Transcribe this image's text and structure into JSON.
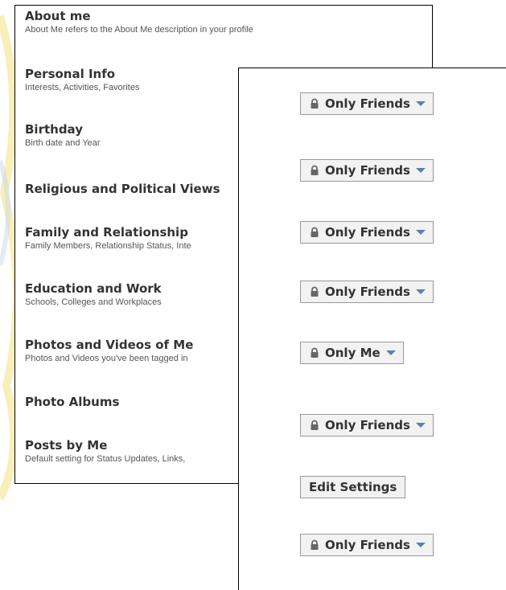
{
  "privacy_items": [
    {
      "title": "About me",
      "desc": "About Me refers to the About Me description in your profile"
    },
    {
      "title": "Personal Info",
      "desc": "Interests, Activities, Favorites"
    },
    {
      "title": "Birthday",
      "desc": "Birth date and Year"
    },
    {
      "title": "Religious and Political Views",
      "desc": ""
    },
    {
      "title": "Family and Relationship",
      "desc": "Family Members, Relationship Status, Inte"
    },
    {
      "title": "Education and Work",
      "desc": "Schools, Colleges and Workplaces"
    },
    {
      "title": "Photos and Videos of Me",
      "desc": "Photos and Videos you've been tagged in"
    },
    {
      "title": "Photo Albums",
      "desc": ""
    },
    {
      "title": "Posts by Me",
      "desc": "Default setting for Status Updates, Links,"
    }
  ],
  "settings": [
    {
      "label": "Only Friends",
      "icon": "lock-icon",
      "dropdown": true
    },
    {
      "label": "Only Friends",
      "icon": "lock-icon",
      "dropdown": true
    },
    {
      "label": "Only Friends",
      "icon": "lock-icon",
      "dropdown": true
    },
    {
      "label": "Only Friends",
      "icon": "lock-icon",
      "dropdown": true
    },
    {
      "label": "Only Me",
      "icon": "lock-icon",
      "dropdown": true
    },
    {
      "label": "Only Friends",
      "icon": "lock-icon",
      "dropdown": true
    },
    {
      "label": "Edit Settings",
      "icon": "",
      "dropdown": false
    },
    {
      "label": "Only Friends",
      "icon": "lock-icon",
      "dropdown": true
    }
  ],
  "colors": {
    "caret": "#5b7fb0",
    "lock": "#666666",
    "button_bg": "#f2f2f2",
    "button_border": "#999999"
  }
}
